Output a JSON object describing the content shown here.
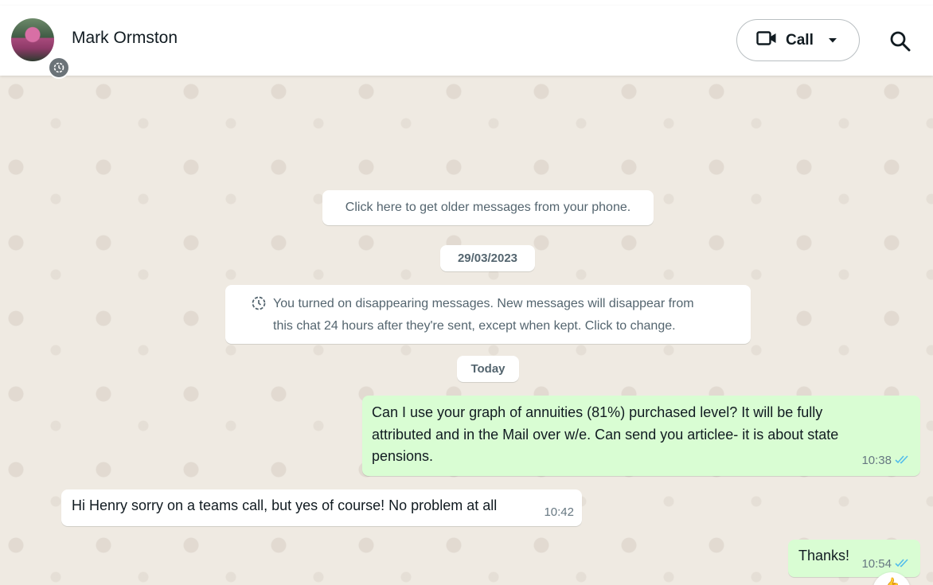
{
  "header": {
    "contact_name": "Mark Ormston",
    "call_label": "Call",
    "icons": [
      "avatar",
      "disappearing-timer-icon",
      "video-camera-icon",
      "caret-down-icon",
      "search-icon"
    ]
  },
  "chat": {
    "older_messages": "Click here to get older messages from your phone.",
    "date_separator": "29/03/2023",
    "disappearing_notice": {
      "line1": "You turned on disappearing messages. New messages will disappear from",
      "line2": "this chat 24 hours after they're sent, except when kept. Click to change."
    },
    "today_separator": "Today",
    "messages": [
      {
        "direction": "outgoing",
        "lines": [
          "Can I use your graph of annuities (81%) purchased level? It will be fully",
          "attributed and in the Mail over w/e. Can send you articlee- it is about state",
          "pensions."
        ],
        "time": "10:38",
        "status": "read"
      },
      {
        "direction": "incoming",
        "text": "Hi Henry sorry on a teams call, but yes of course! No problem at all",
        "time": "10:42"
      },
      {
        "direction": "outgoing",
        "text": "Thanks!",
        "time": "10:54",
        "status": "read"
      }
    ]
  },
  "colors": {
    "outgoing_bubble": "#d9fdd3",
    "incoming_bubble": "#ffffff",
    "chat_background": "#efeae2",
    "read_ticks": "#53bdeb"
  }
}
